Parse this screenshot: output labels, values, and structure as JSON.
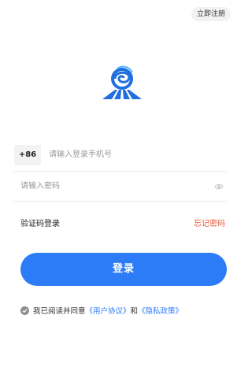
{
  "header": {
    "register_label": "立即注册"
  },
  "logo": {
    "icon": "app-logo-icon"
  },
  "form": {
    "country_code": "+86",
    "phone_placeholder": "请输入登录手机号",
    "password_placeholder": "请输入密码",
    "eye_icon": "eye-icon"
  },
  "links": {
    "sms_login": "验证码登录",
    "forgot_password": "忘记密码"
  },
  "login_button": "登录",
  "agreement": {
    "prefix": "我已阅读并同意",
    "user_agreement": "《用户协议》",
    "and": "和",
    "privacy_policy": "《隐私政策》"
  },
  "colors": {
    "primary": "#2d7cf7",
    "forgot": "#e35a3c",
    "placeholder": "#9a9a9a"
  }
}
